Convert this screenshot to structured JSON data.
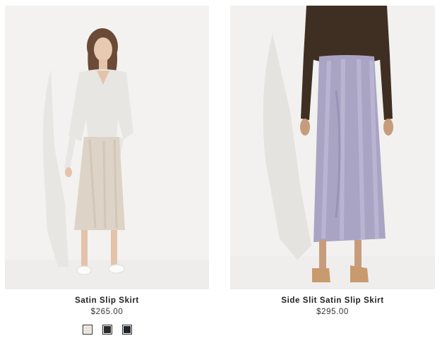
{
  "products": [
    {
      "name": "Satin Slip Skirt",
      "price": "$265.00",
      "swatches": [
        {
          "color": "#e9e3d8"
        },
        {
          "color": "#2a2a2a"
        },
        {
          "color": "#1f232a"
        }
      ]
    },
    {
      "name": "Side Slit Satin Slip Skirt",
      "price": "$295.00"
    }
  ]
}
